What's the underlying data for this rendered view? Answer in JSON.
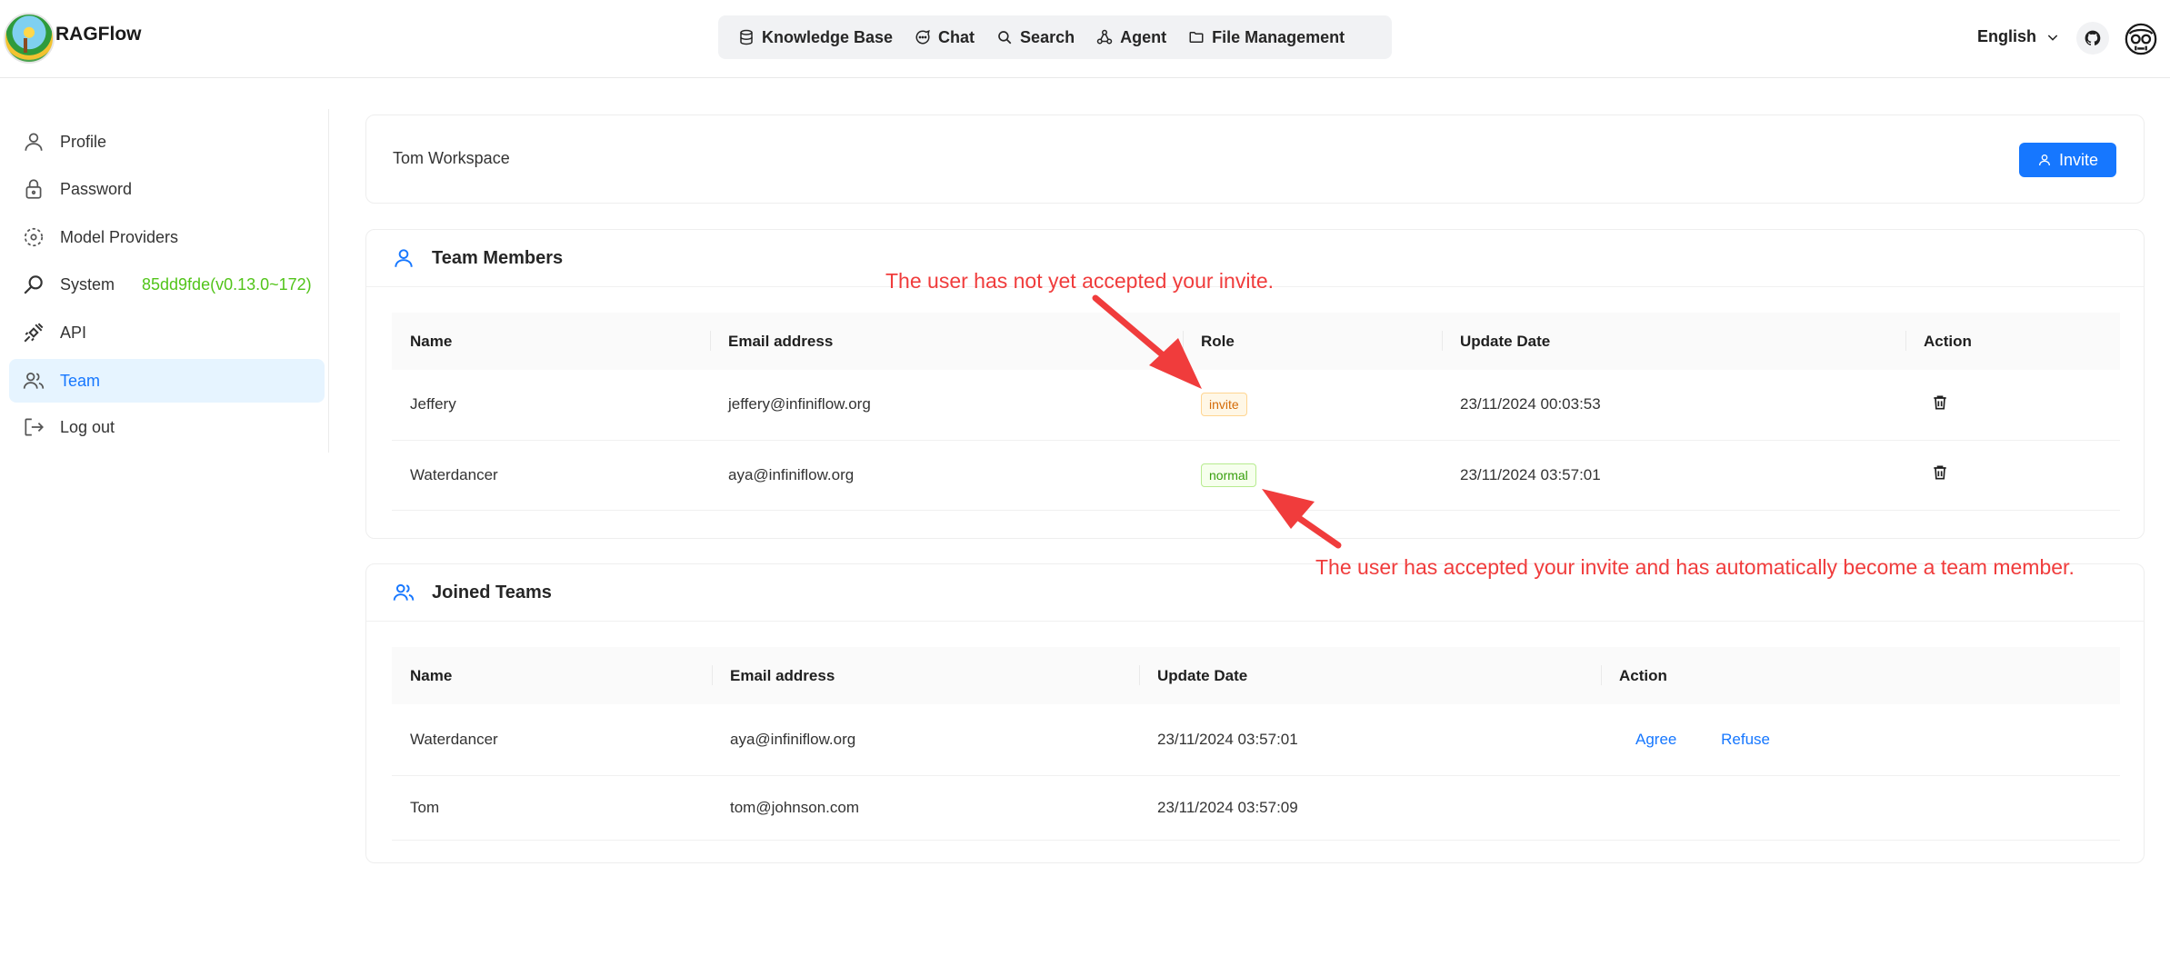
{
  "app": {
    "name": "RAGFlow"
  },
  "nav": {
    "items": [
      {
        "label": "Knowledge Base",
        "icon": "database-icon"
      },
      {
        "label": "Chat",
        "icon": "chat-bubble-icon"
      },
      {
        "label": "Search",
        "icon": "search-icon"
      },
      {
        "label": "Agent",
        "icon": "agent-graph-icon"
      },
      {
        "label": "File Management",
        "icon": "folder-icon"
      }
    ]
  },
  "header": {
    "language": "English"
  },
  "sidebar": {
    "items": [
      {
        "label": "Profile",
        "icon": "user-icon"
      },
      {
        "label": "Password",
        "icon": "lock-icon"
      },
      {
        "label": "Model Providers",
        "icon": "model-providers-icon"
      },
      {
        "label": "System",
        "icon": "system-search-icon"
      },
      {
        "label": "API",
        "icon": "plug-icon"
      },
      {
        "label": "Team",
        "icon": "team-icon"
      },
      {
        "label": "Log out",
        "icon": "logout-icon"
      }
    ],
    "version": "85dd9fde(v0.13.0~172)",
    "active": "Team"
  },
  "workspace": {
    "name": "Tom Workspace",
    "invite_label": "Invite"
  },
  "team_members": {
    "title": "Team Members",
    "columns": [
      "Name",
      "Email address",
      "Role",
      "Update Date",
      "Action"
    ],
    "rows": [
      {
        "name": "Jeffery",
        "email": "jeffery@infiniflow.org",
        "role": "invite",
        "date": "23/11/2024 00:03:53"
      },
      {
        "name": "Waterdancer",
        "email": "aya@infiniflow.org",
        "role": "normal",
        "date": "23/11/2024 03:57:01"
      }
    ]
  },
  "joined_teams": {
    "title": "Joined Teams",
    "columns": [
      "Name",
      "Email address",
      "Update Date",
      "Action"
    ],
    "rows": [
      {
        "name": "Waterdancer",
        "email": "aya@infiniflow.org",
        "date": "23/11/2024 03:57:01",
        "agree": "Agree",
        "refuse": "Refuse"
      },
      {
        "name": "Tom",
        "email": "tom@johnson.com",
        "date": "23/11/2024 03:57:09"
      }
    ]
  },
  "annotations": {
    "not_accepted": "The user has not yet accepted your invite.",
    "accepted": "The user has accepted your invite and has automatically become a team member."
  },
  "colors": {
    "primary": "#1677ff",
    "annotation": "#f03c3c",
    "version_green": "#52c41a"
  }
}
